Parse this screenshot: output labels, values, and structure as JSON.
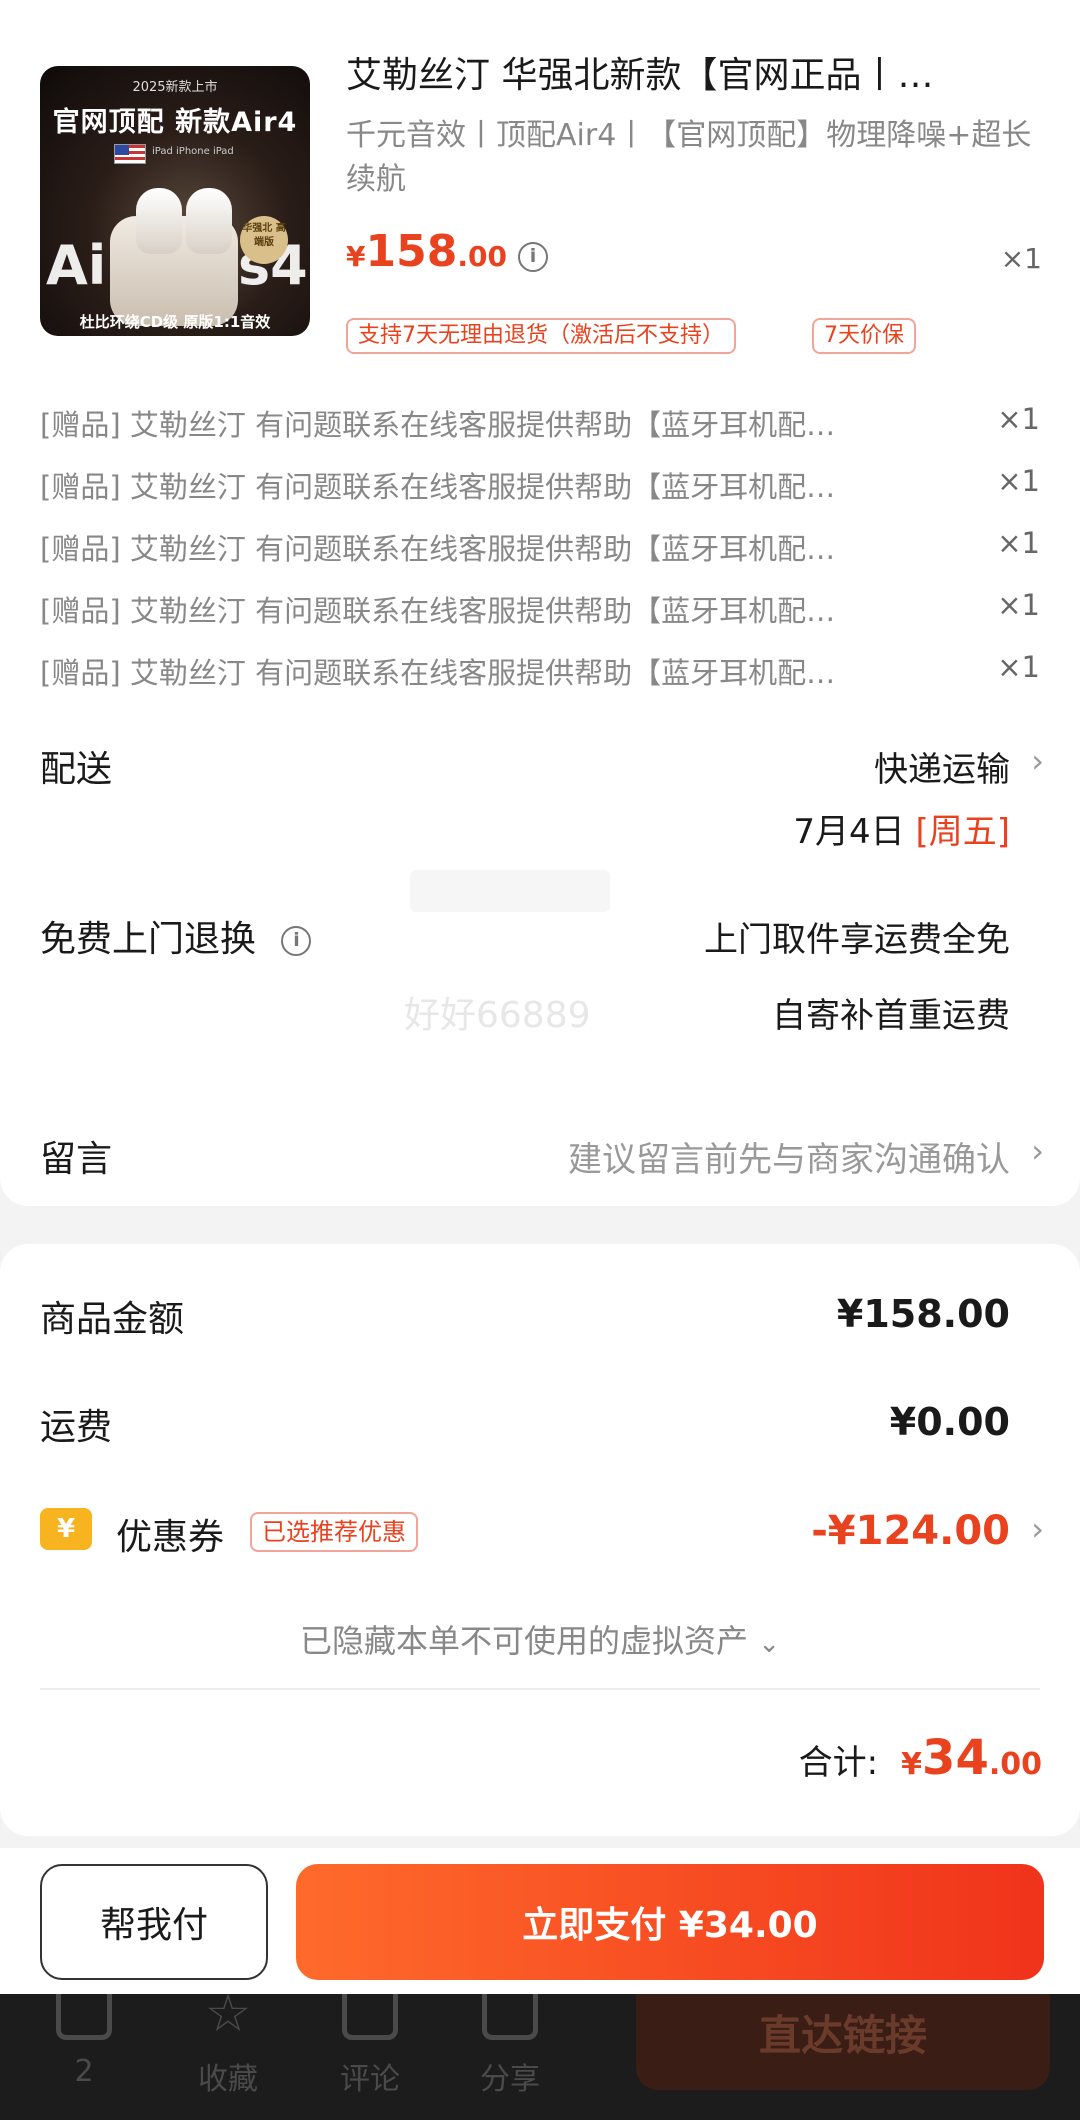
{
  "product": {
    "image_text": {
      "top": "2025新款上市",
      "headline": "官网顶配  新款Air4",
      "tags": "iPad iPhone iPad",
      "badge": "华强北 高端版",
      "big_left": "Ai",
      "big_right": "s4",
      "bottom": "杜比环绕CD级 原版1:1音效"
    },
    "title": "艾勒丝汀 华强北新款【官网正品丨…",
    "spec": "千元音效丨顶配Air4丨【官网顶配】物理降噪+超长续航",
    "price_symbol": "¥",
    "price_int": "158",
    "price_dec": ".00",
    "qty": "×1",
    "tags": [
      "支持7天无理由退货（激活后不支持）",
      "7天价保"
    ]
  },
  "gifts": [
    {
      "text": "[赠品] 艾勒丝汀 有问题联系在线客服提供帮助【蓝牙耳机配…",
      "qty": "×1"
    },
    {
      "text": "[赠品] 艾勒丝汀 有问题联系在线客服提供帮助【蓝牙耳机配…",
      "qty": "×1"
    },
    {
      "text": "[赠品] 艾勒丝汀 有问题联系在线客服提供帮助【蓝牙耳机配…",
      "qty": "×1"
    },
    {
      "text": "[赠品] 艾勒丝汀 有问题联系在线客服提供帮助【蓝牙耳机配…",
      "qty": "×1"
    },
    {
      "text": "[赠品] 艾勒丝汀 有问题联系在线客服提供帮助【蓝牙耳机配…",
      "qty": "×1"
    }
  ],
  "delivery": {
    "label": "配送",
    "method": "快递运输",
    "date": "7月4日",
    "weekday": "[周五]"
  },
  "returns": {
    "label": "免费上门退换",
    "line1": "上门取件享运费全免",
    "line2": "自寄补首重运费"
  },
  "watermark": "好好66889",
  "message": {
    "label": "留言",
    "placeholder": "建议留言前先与商家沟通确认"
  },
  "summary": {
    "goods_label": "商品金额",
    "goods_value": "¥158.00",
    "shipping_label": "运费",
    "shipping_value": "¥0.00",
    "coupon_icon": "¥",
    "coupon_label": "优惠券",
    "coupon_tag": "已选推荐优惠",
    "coupon_value": "-¥124.00",
    "hidden_note": "已隐藏本单不可使用的虚拟资产",
    "total_label": "合计:",
    "total_symbol": "¥",
    "total_int": "34",
    "total_dec": ".00"
  },
  "actions": {
    "help_pay": "帮我付",
    "pay_now": "立即支付 ¥34.00"
  },
  "underlay": {
    "items": [
      {
        "label": "2"
      },
      {
        "label": "收藏"
      },
      {
        "label": "评论"
      },
      {
        "label": "分享"
      }
    ],
    "link": "直达链接"
  },
  "colors": {
    "accent": "#e8421f",
    "coupon": "#f7b320",
    "pay_gradient": [
      "#ff6a2b",
      "#f0331b"
    ]
  }
}
